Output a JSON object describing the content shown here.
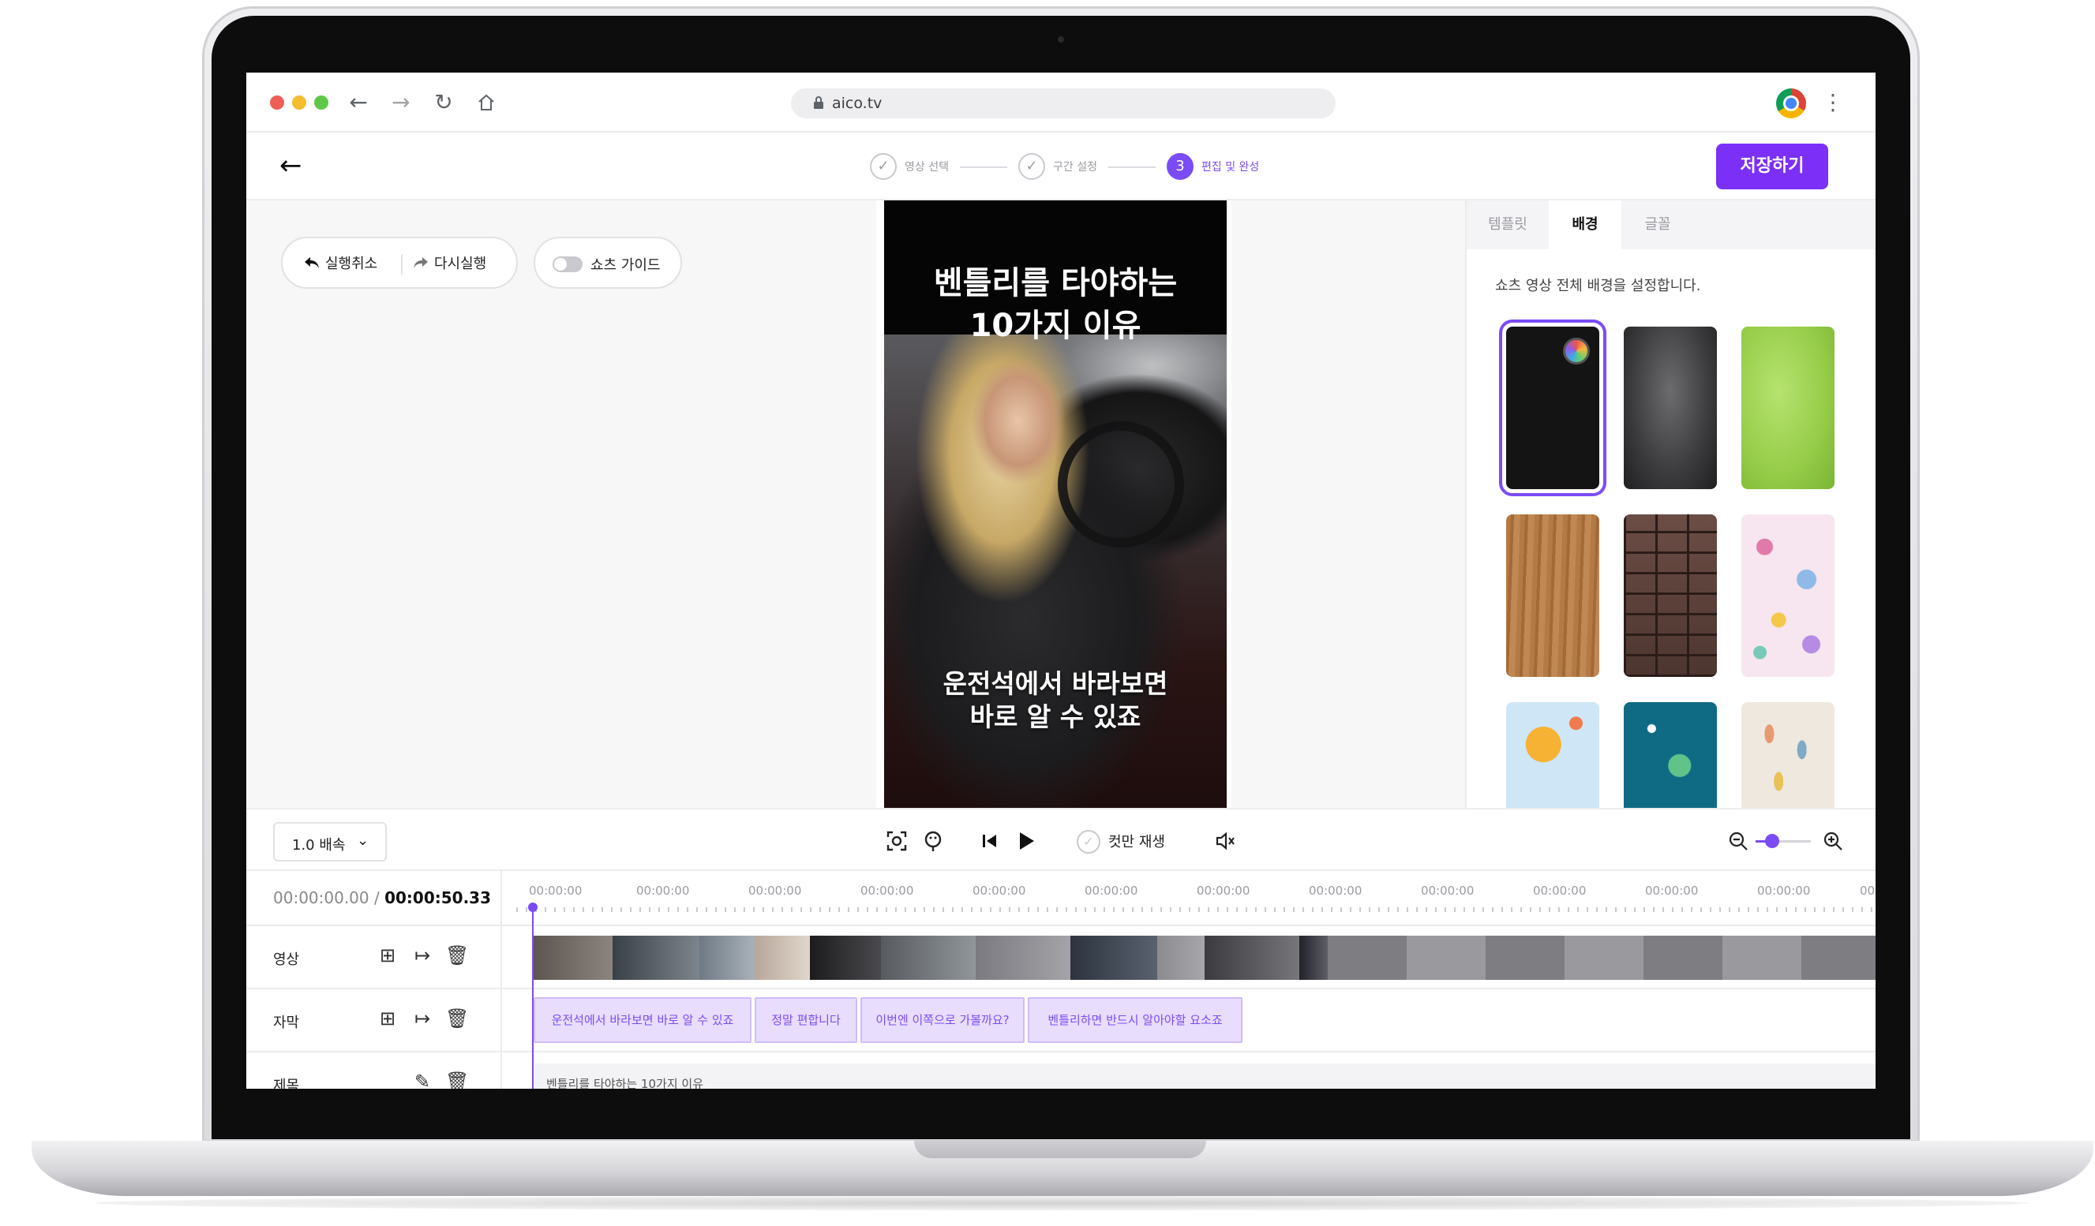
{
  "browser": {
    "url": "aico.tv",
    "back_icon": "back-arrow-icon",
    "forward_icon": "forward-arrow-icon",
    "reload_icon": "reload-icon",
    "home_icon": "home-icon"
  },
  "header": {
    "steps": [
      {
        "label": "영상 선택",
        "state": "done"
      },
      {
        "label": "구간 설정",
        "state": "done"
      },
      {
        "label": "편집 및 완성",
        "number": "3",
        "state": "active"
      }
    ],
    "save_label": "저장하기"
  },
  "editor": {
    "undo_label": "실행취소",
    "redo_label": "다시실행",
    "guide_label": "쇼츠 가이드",
    "guide_on": false
  },
  "preview": {
    "title": "벤틀리를 타야하는\n10가지 이유",
    "caption": "운전석에서 바라보면\n바로 알 수 있죠"
  },
  "panel": {
    "tabs": [
      "템플릿",
      "배경",
      "글꼴"
    ],
    "active_tab": "배경",
    "description": "쇼츠 영상 전체 배경을 설정합니다.",
    "backgrounds": [
      "black-solid",
      "dark-grunge",
      "green-texture",
      "wood",
      "brick",
      "terrazzo",
      "sun-pattern",
      "teal-leaf-pattern",
      "raindrop-pattern"
    ],
    "selected_background": "black-solid"
  },
  "toolbar": {
    "speed_label": "1.0 배속",
    "cut_play_label": "컷만 재생",
    "zoom_level": 0.3
  },
  "timeline": {
    "current_time": "00:00:00.00",
    "separator": " / ",
    "total_time": "00:00:50.33",
    "ruler_label": "00:00:00",
    "ruler_last": "00",
    "tracks": {
      "video_label": "영상",
      "subtitle_label": "자막",
      "title_label": "제목"
    },
    "subtitles": [
      "운전석에서 바라보면 바로 알 수 있죠",
      "정말 편합니다",
      "이번엔 이쪽으로 가볼까요?",
      "벤틀리하면 반드시 알아야할 요소죠"
    ],
    "title_text": "벤틀리를 타야하는 10가지 이유"
  },
  "colors": {
    "accent": "#7b4cf5",
    "save_button": "#7b2ff7",
    "subtitle_clip_bg": "#e9ddfd"
  }
}
